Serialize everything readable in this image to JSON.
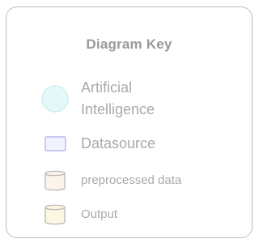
{
  "legend": {
    "title": "Diagram Key",
    "items": [
      {
        "label_line1": "Artificial",
        "label_line2": "Intelligence",
        "shape": "circle-icon",
        "fill": "#e6f7f7",
        "stroke": "#d2eeee"
      },
      {
        "label": "Datasource",
        "shape": "rectangle-icon",
        "fill": "#f3f3ff",
        "stroke": "#b9b9f2"
      },
      {
        "label": "preprocessed data",
        "shape": "cylinder-icon",
        "fill": "#fcf4ec",
        "stroke": "#b8b8b8"
      },
      {
        "label": "Output",
        "shape": "cylinder-icon",
        "fill": "#fdf7e1",
        "stroke": "#b8b8b8"
      }
    ]
  }
}
